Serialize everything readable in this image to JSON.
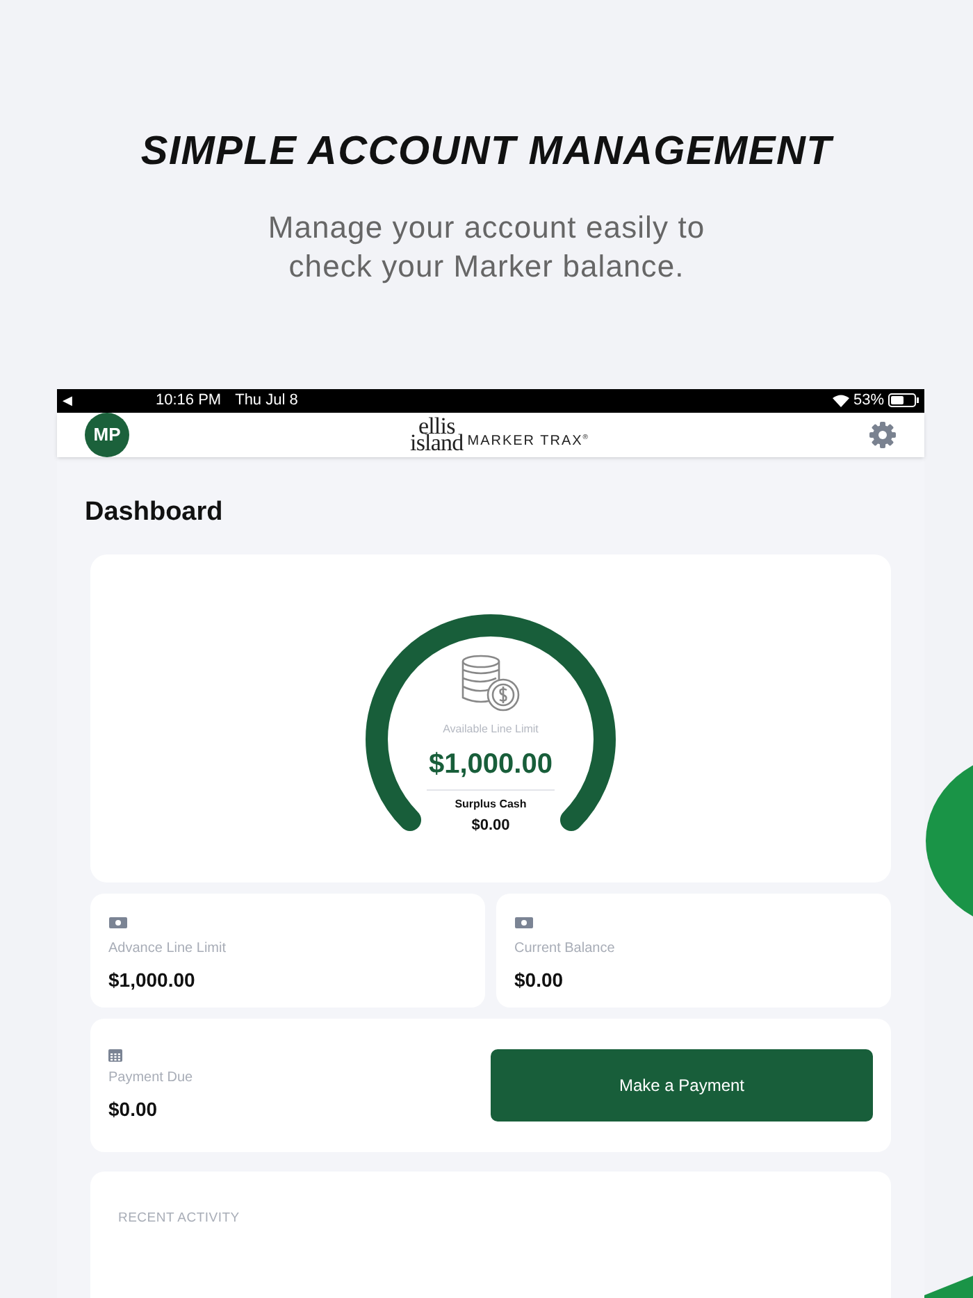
{
  "promo": {
    "title": "SIMPLE ACCOUNT MANAGEMENT",
    "subtitle": "Manage your account easily to check your Marker balance."
  },
  "status_bar": {
    "back": "◀",
    "time": "10:16 PM",
    "date": "Thu Jul 8",
    "battery": "53%"
  },
  "header": {
    "avatar": "MP",
    "logo": {
      "top": "ellis",
      "bottom": "island",
      "brand": "MARKER TRAX",
      "mark": "®"
    }
  },
  "page_title": "Dashboard",
  "gauge": {
    "label": "Available Line Limit",
    "amount": "$1,000.00",
    "sub_label": "Surplus Cash",
    "sub_amount": "$0.00"
  },
  "stats": [
    {
      "label": "Advance Line Limit",
      "amount": "$1,000.00"
    },
    {
      "label": "Current Balance",
      "amount": "$0.00"
    }
  ],
  "payment": {
    "label": "Payment Due",
    "amount": "$0.00",
    "button": "Make a Payment"
  },
  "recent_activity": {
    "title": "RECENT ACTIVITY"
  }
}
